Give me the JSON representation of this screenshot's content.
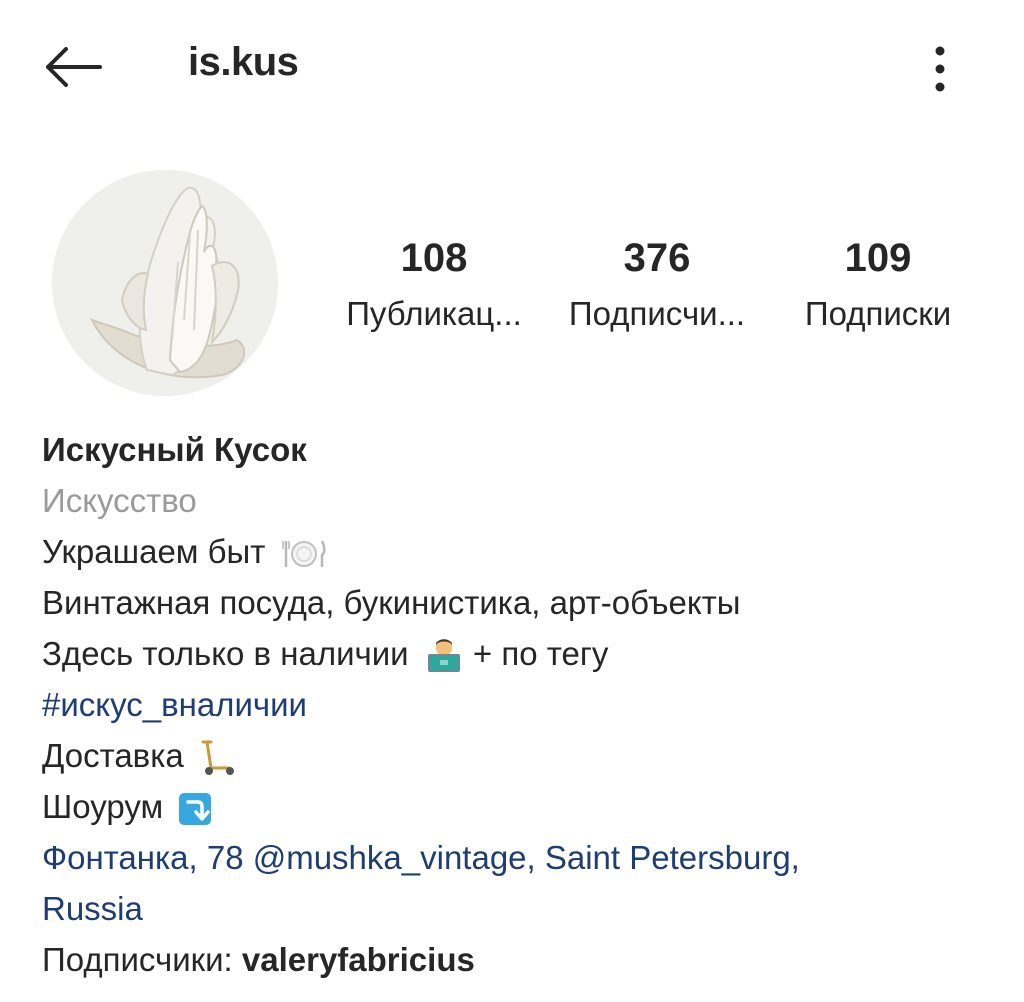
{
  "header": {
    "username": "is.kus",
    "back_icon": "arrow-left-icon",
    "more_icon": "more-vertical-icon"
  },
  "avatar": {
    "icon": "praying-hands-sculpture"
  },
  "stats": {
    "posts": {
      "count": "108",
      "label": "Публикац..."
    },
    "followers": {
      "count": "376",
      "label": "Подписчи..."
    },
    "following": {
      "count": "109",
      "label": "Подписки"
    }
  },
  "bio": {
    "name": "Искусный Кусок",
    "category": "Искусство",
    "line1": "Украшаем быт",
    "line1_emoji": "plate-fork-knife-icon",
    "line2": "Винтажная посуда, букинистика, арт-объекты",
    "line3_before": "Здесь только в наличии",
    "line3_emoji": "technologist-icon",
    "line3_after": "+ по тегу",
    "hashtag": "#искус_вналичии",
    "delivery": "Доставка",
    "delivery_emoji": "scooter-icon",
    "showroom": "Шоурум",
    "showroom_emoji": "arrow-down-box-icon",
    "address_line1": "Фонтанка, 78 @mushka_vintage, Saint Petersburg,",
    "address_line2": "Russia",
    "followed_by_prefix": "Подписчики:",
    "followed_by_user": "valeryfabricius"
  },
  "colors": {
    "text": "#262626",
    "secondary": "#9a9a9a",
    "link": "#1e3d72",
    "emoji_blue": "#36a7e0"
  }
}
